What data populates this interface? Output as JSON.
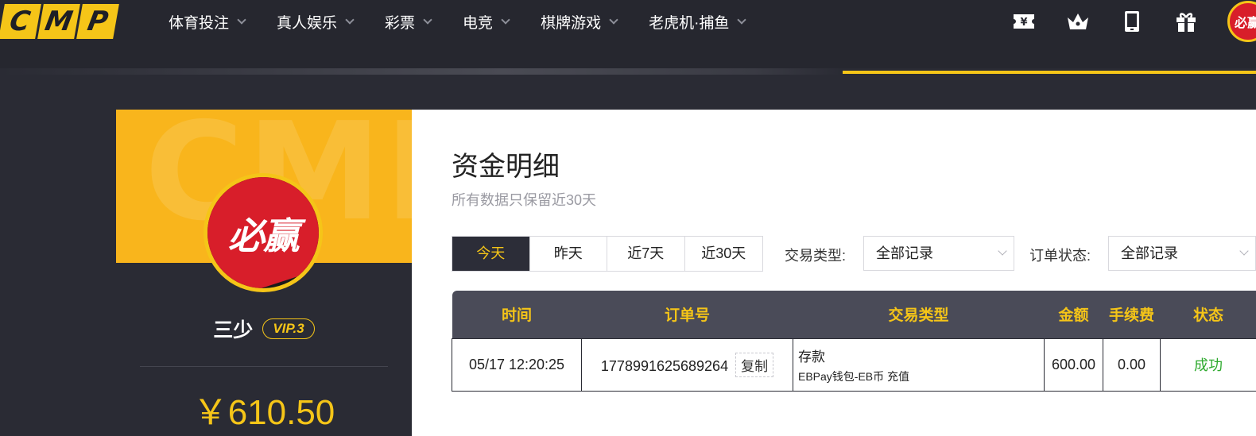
{
  "logo": {
    "letters": [
      "C",
      "M",
      "P"
    ]
  },
  "nav": {
    "items": [
      {
        "label": "体育投注"
      },
      {
        "label": "真人娱乐"
      },
      {
        "label": "彩票"
      },
      {
        "label": "电竞"
      },
      {
        "label": "棋牌游戏"
      },
      {
        "label": "老虎机·捕鱼"
      }
    ],
    "icons": [
      "yen-ticket-icon",
      "crown-icon",
      "tablet-icon",
      "gift-icon"
    ],
    "avatar_text": "必赢"
  },
  "profile": {
    "watermark": "CMP",
    "avatar_text": "必赢",
    "name": "三少",
    "vip": "VIP.3",
    "balance": "￥610.50"
  },
  "main": {
    "title": "资金明细",
    "subtitle": "所有数据只保留近30天",
    "day_tabs": [
      {
        "label": "今天",
        "active": true
      },
      {
        "label": "昨天",
        "active": false
      },
      {
        "label": "近7天",
        "active": false
      },
      {
        "label": "近30天",
        "active": false
      }
    ],
    "filters": {
      "type_label": "交易类型:",
      "type_value": "全部记录",
      "status_label": "订单状态:",
      "status_value": "全部记录"
    },
    "table": {
      "headers": [
        "时间",
        "订单号",
        "交易类型",
        "金额",
        "手续费",
        "状态"
      ],
      "rows": [
        {
          "time": "05/17 12:20:25",
          "order_no": "1778991625689264",
          "copy_label": "复制",
          "type_main": "存款",
          "type_sub": "EBPay钱包-EB币 充值",
          "amount": "600.00",
          "fee": "0.00",
          "status": "成功"
        }
      ]
    }
  },
  "colors": {
    "accent": "#f5c518",
    "dark": "#2a2b34",
    "success": "#2eaa2e",
    "brand_red": "#d81e2a"
  }
}
